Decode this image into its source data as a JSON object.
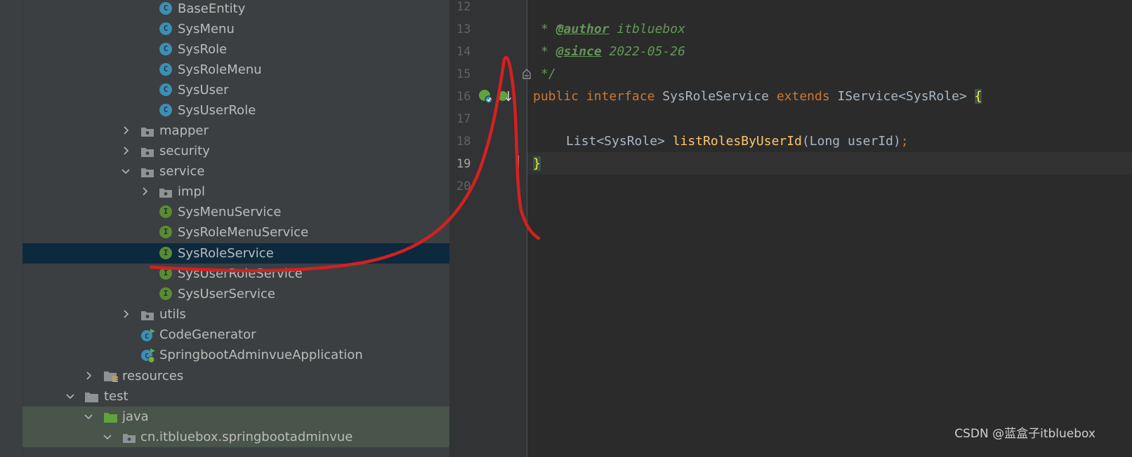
{
  "tree": {
    "items": [
      {
        "label": "BaseEntity",
        "kind": "class"
      },
      {
        "label": "SysMenu",
        "kind": "class"
      },
      {
        "label": "SysRole",
        "kind": "class"
      },
      {
        "label": "SysRoleMenu",
        "kind": "class"
      },
      {
        "label": "SysUser",
        "kind": "class"
      },
      {
        "label": "SysUserRole",
        "kind": "class"
      },
      {
        "label": "mapper",
        "kind": "package",
        "state": "collapsed"
      },
      {
        "label": "security",
        "kind": "package",
        "state": "collapsed"
      },
      {
        "label": "service",
        "kind": "package",
        "state": "expanded"
      },
      {
        "label": "impl",
        "kind": "package",
        "state": "collapsed"
      },
      {
        "label": "SysMenuService",
        "kind": "interface"
      },
      {
        "label": "SysRoleMenuService",
        "kind": "interface"
      },
      {
        "label": "SysRoleService",
        "kind": "interface",
        "selected": true
      },
      {
        "label": "SysUserRoleService",
        "kind": "interface"
      },
      {
        "label": "SysUserService",
        "kind": "interface"
      },
      {
        "label": "utils",
        "kind": "package",
        "state": "collapsed"
      },
      {
        "label": "CodeGenerator",
        "kind": "runnable-class"
      },
      {
        "label": "SpringbootAdminvueApplication",
        "kind": "spring-app-class"
      },
      {
        "label": "resources",
        "kind": "resources-folder",
        "state": "collapsed"
      },
      {
        "label": "test",
        "kind": "folder",
        "state": "expanded"
      },
      {
        "label": "java",
        "kind": "test-source-folder",
        "state": "expanded"
      },
      {
        "label": "cn.itbluebox.springbootadminvue",
        "kind": "package",
        "state": "expanded"
      }
    ],
    "badges": {
      "class": "C",
      "interface": "I"
    }
  },
  "editor": {
    "line_numbers": [
      "12",
      "13",
      "14",
      "15",
      "16",
      "17",
      "18",
      "19",
      "20"
    ],
    "current_line": "19",
    "lines": {
      "l12": {
        "star": "*"
      },
      "l13": {
        "star": "* ",
        "tag": "@author",
        "value": " itbluebox"
      },
      "l14": {
        "star": "* ",
        "tag": "@since",
        "value": " 2022-05-26"
      },
      "l15": {
        "end": "*/"
      },
      "l16": {
        "kw1": "public",
        "sp1": " ",
        "kw2": "interface",
        "name": " SysRoleService ",
        "kw3": "extends",
        "rest": " IService<SysRole> ",
        "brace": "{"
      },
      "l18": {
        "type": "List<SysRole> ",
        "method": "listRolesByUserId",
        "params": "(Long userId)",
        "semi": ";"
      },
      "l19": {
        "brace": "}"
      }
    }
  },
  "colors": {
    "tree_bg": "#3c3f41",
    "selection": "#0d293e",
    "editor_bg": "#2b2b2b",
    "keyword": "#cc7832",
    "doc_comment": "#629755",
    "method": "#ffc66d",
    "annotation_stroke": "#d42020"
  },
  "watermark": "CSDN @蓝盒子itbluebox"
}
